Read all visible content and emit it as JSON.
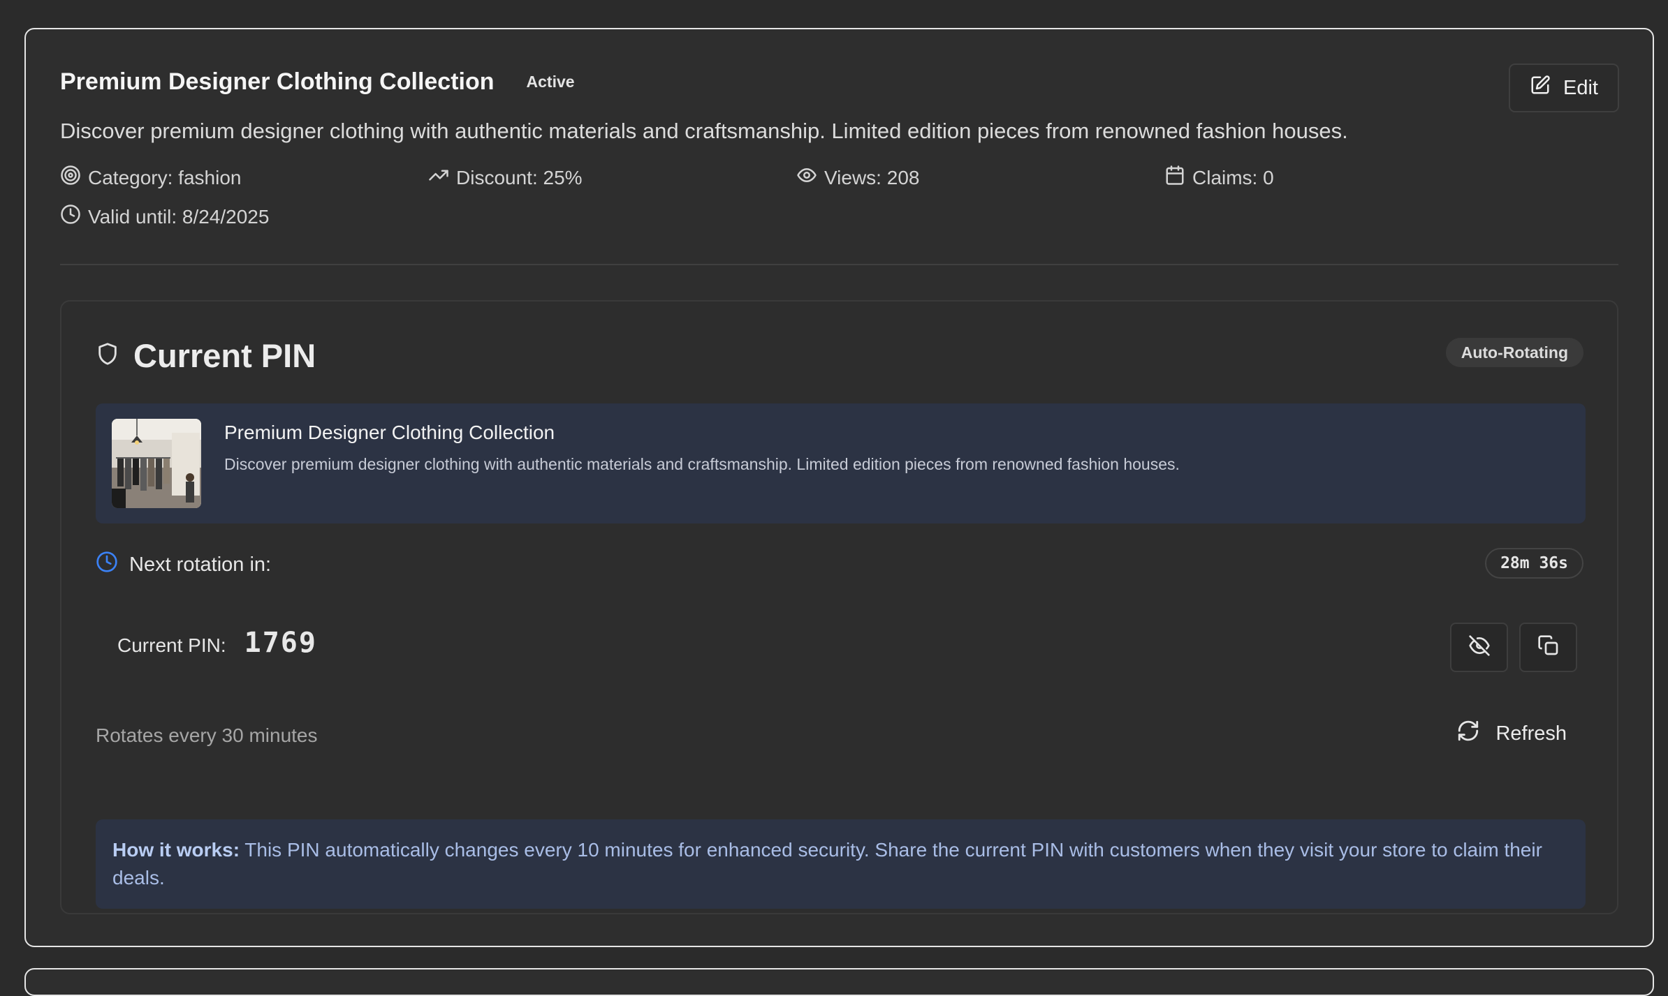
{
  "deal": {
    "title": "Premium Designer Clothing Collection",
    "status": "Active",
    "edit_label": "Edit",
    "description": "Discover premium designer clothing with authentic materials and craftsmanship. Limited edition pieces from renowned fashion houses.",
    "meta": {
      "category": "Category: fashion",
      "discount": "Discount: 25%",
      "views": "Views: 208",
      "claims": "Claims: 0",
      "valid_until": "Valid until: 8/24/2025"
    }
  },
  "pin_card": {
    "title": "Current PIN",
    "badge": "Auto-Rotating",
    "deal_title": "Premium Designer Clothing Collection",
    "deal_description": "Discover premium designer clothing with authentic materials and craftsmanship. Limited edition pieces from renowned fashion houses.",
    "next_rotation_label": "Next rotation in:",
    "timer": "28m 36s",
    "current_pin_label": "Current PIN:",
    "current_pin_value": "1769",
    "rotates_text": "Rotates every 30 minutes",
    "refresh_label": "Refresh",
    "how_it_works_label": "How it works:",
    "how_it_works_text": " This PIN automatically changes every 10 minutes for enhanced security. Share the current PIN with customers when they visit your store to claim their deals."
  },
  "colors": {
    "background": "#2b2b2b",
    "info_box": "#2c3344",
    "accent_clock": "#3b82f6",
    "how_text": "#a9bde6"
  },
  "icons": [
    "target-icon",
    "trending-up-icon",
    "eye-icon",
    "calendar-icon",
    "clock-icon",
    "edit-icon",
    "shield-icon",
    "eye-off-icon",
    "copy-icon",
    "refresh-icon"
  ]
}
